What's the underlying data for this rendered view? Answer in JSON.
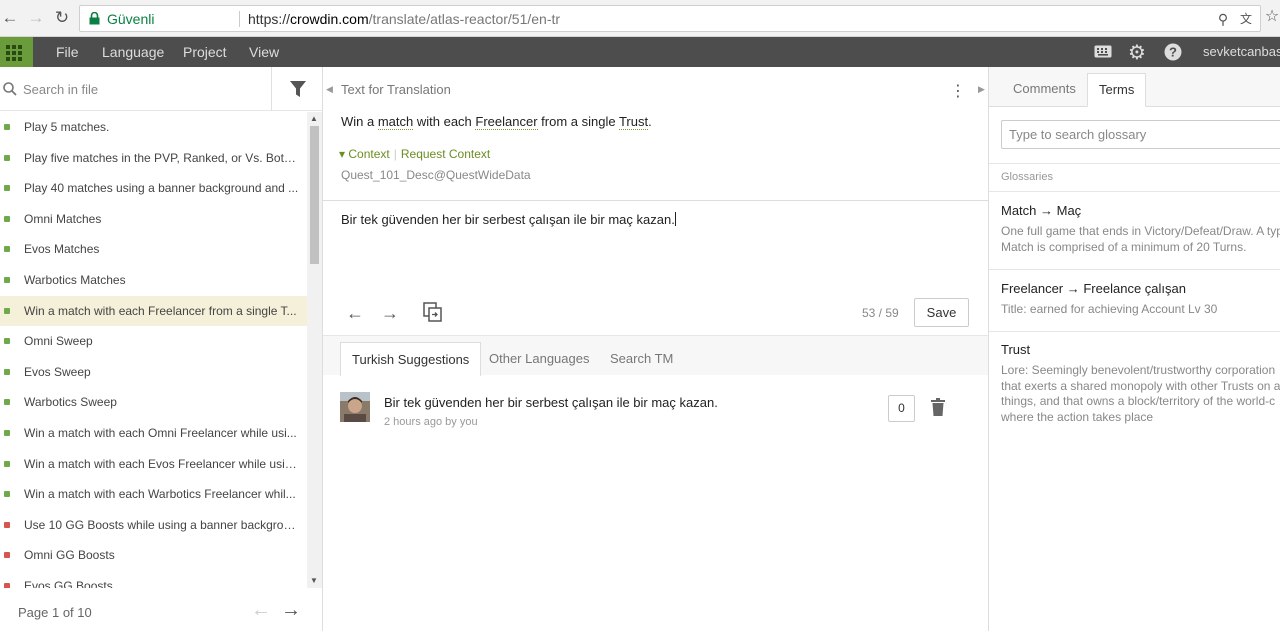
{
  "browser": {
    "secure_label": "Güvenli",
    "url_protocol": "https://",
    "url_domain": "crowdin.com",
    "url_path": "/translate/atlas-reactor/51/en-tr"
  },
  "menu": {
    "items": [
      "File",
      "Language",
      "Project",
      "View"
    ],
    "user": "sevketcanbas"
  },
  "sidebar": {
    "search_placeholder": "Search in file",
    "strings": [
      {
        "text": "Play 5 matches.",
        "status": "green"
      },
      {
        "text": "Play five matches in the PVP, Ranked, or Vs. Bots ...",
        "status": "green"
      },
      {
        "text": "Play 40 matches using a banner background and ...",
        "status": "green"
      },
      {
        "text": "Omni Matches",
        "status": "green"
      },
      {
        "text": "Evos Matches",
        "status": "green"
      },
      {
        "text": "Warbotics Matches",
        "status": "green"
      },
      {
        "text": "Win a match with each Freelancer from a single T...",
        "status": "green",
        "active": true
      },
      {
        "text": "Omni Sweep",
        "status": "green"
      },
      {
        "text": "Evos Sweep",
        "status": "green"
      },
      {
        "text": "Warbotics Sweep",
        "status": "green"
      },
      {
        "text": "Win a match with each Omni Freelancer while usi...",
        "status": "green"
      },
      {
        "text": "Win a match with each Evos Freelancer while usin...",
        "status": "green"
      },
      {
        "text": "Win a match with each Warbotics Freelancer whil...",
        "status": "green"
      },
      {
        "text": "Use 10 GG Boosts while using a banner backgrou...",
        "status": "red"
      },
      {
        "text": "Omni GG Boosts",
        "status": "red"
      },
      {
        "text": "Evos GG Boosts",
        "status": "red"
      }
    ],
    "pager": "Page 1 of 10"
  },
  "editor": {
    "label": "Text for Translation",
    "source_parts": [
      "Win a ",
      "match",
      " with each ",
      "Freelancer",
      " from a single ",
      "Trust",
      "."
    ],
    "context_label": "Context",
    "request_context_label": "Request Context",
    "identifier": "Quest_101_Desc@QuestWideData",
    "translation": "Bir tek güvenden her bir serbest çalışan ile bir maç kazan.",
    "counter": "53 / 59",
    "save_label": "Save",
    "tabs": [
      "Turkish Suggestions",
      "Other Languages",
      "Search TM"
    ],
    "suggestion": {
      "text": "Bir tek güvenden her bir serbest çalışan ile bir maç kazan.",
      "meta": "2 hours ago by you",
      "votes": "0"
    }
  },
  "right": {
    "tabs": [
      "Comments",
      "Terms"
    ],
    "search_placeholder": "Type to search glossary",
    "glossaries_label": "Glossaries",
    "terms": [
      {
        "title": "Match → Maç",
        "desc": [
          "One full game that ends in Victory/Defeat/Draw. A typ",
          "Match is comprised of a minimum of 20 Turns."
        ]
      },
      {
        "title": "Freelancer → Freelance çalışan",
        "desc": [
          "Title: earned for achieving Account Lv 30"
        ]
      },
      {
        "title": "Trust",
        "desc": [
          "Lore: Seemingly benevolent/trustworthy corporation",
          "that exerts a shared monopoly with other Trusts on a",
          "things, and that owns a block/territory of the world-c",
          "where the action takes place"
        ]
      }
    ]
  },
  "colors": {
    "accent": "#6b9c3b",
    "appbar": "#4d4d4d",
    "active_row": "#f5f0d9"
  }
}
